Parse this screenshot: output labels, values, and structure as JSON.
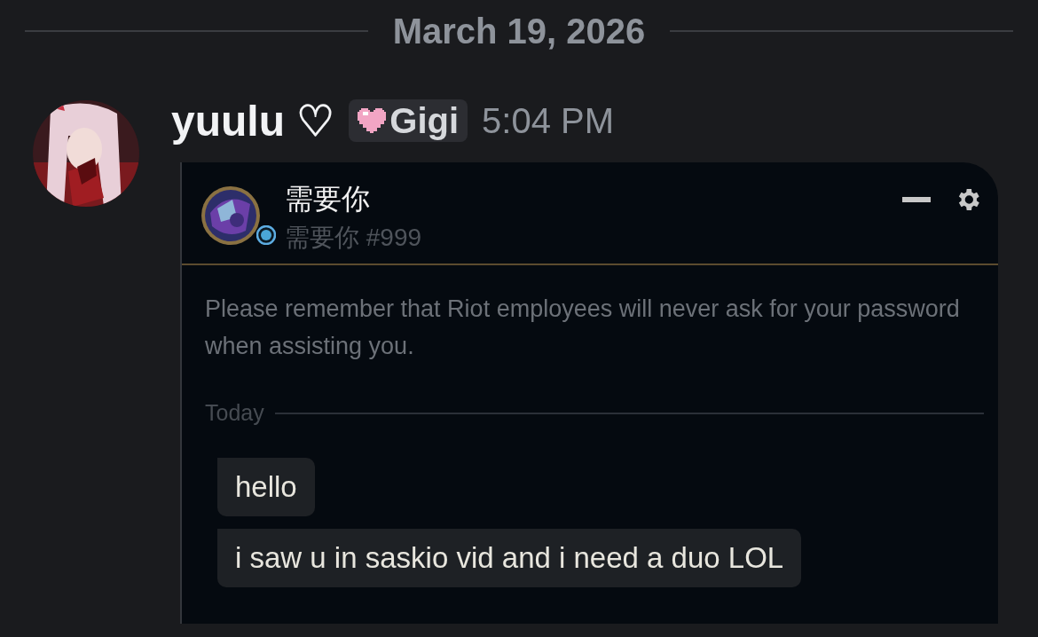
{
  "date_divider": "March 19, 2026",
  "message": {
    "author": "yuulu ♡",
    "tag": "Gigi",
    "time": "5:04 PM",
    "attachment": {
      "contact": {
        "name": "需要你",
        "riot_id": "需要你 #999"
      },
      "notice": "Please remember that Riot employees will never ask for your password when assisting you.",
      "day_divider": "Today",
      "messages": [
        {
          "text": "hello"
        },
        {
          "text": "i saw u in saskio vid and i need a duo LOL"
        }
      ]
    }
  }
}
